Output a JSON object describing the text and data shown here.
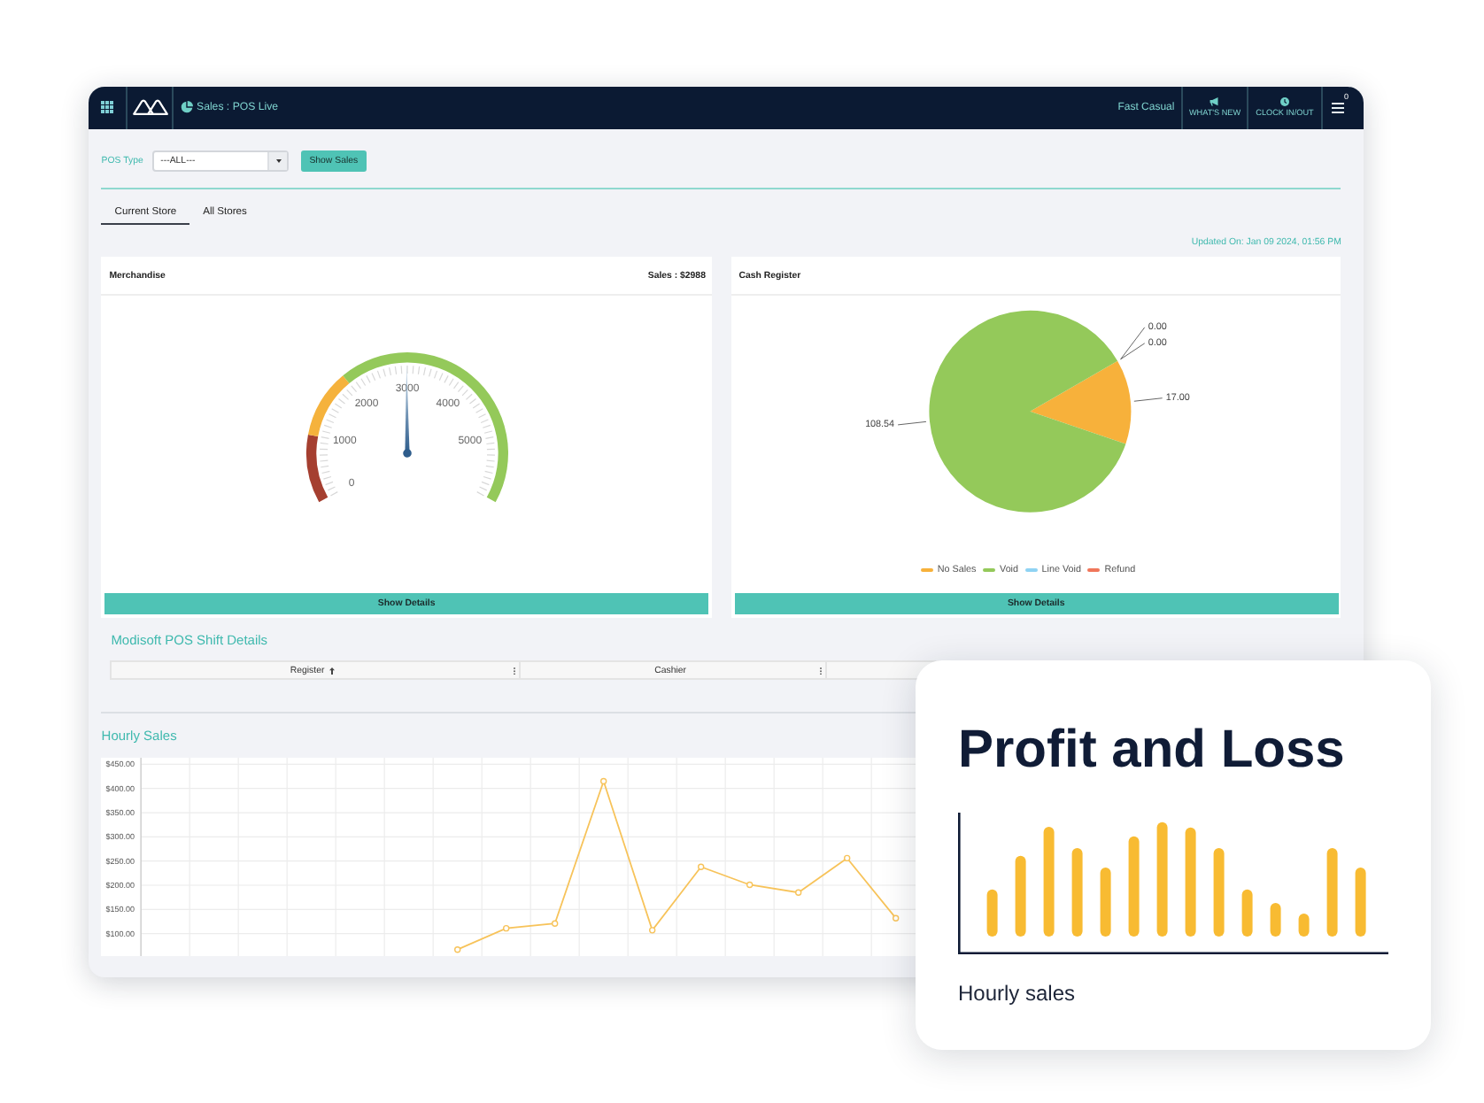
{
  "top_bar": {
    "breadcrumb": "Sales : POS Live",
    "store_type": "Fast Casual",
    "actions": [
      {
        "label": "WHAT'S NEW"
      },
      {
        "label": "CLOCK IN/OUT"
      }
    ],
    "menu_badge": "0"
  },
  "filters": {
    "label": "POS Type",
    "select": {
      "value": "---ALL---"
    },
    "button": "Show Sales"
  },
  "tabs": [
    {
      "label": "Current Store",
      "selected": true
    },
    {
      "label": "All Stores",
      "selected": false
    }
  ],
  "updated": "Updated On: Jan 09 2024, 01:56 PM",
  "cards": [
    {
      "kind": "gauge",
      "title": "Merchandise",
      "total": "Sales : $2988",
      "gauge": {
        "ticks": [
          "0",
          "1000",
          "2000",
          "3000",
          "4000",
          "5000"
        ],
        "level": 0.498,
        "bands": [
          {
            "color": "#a53f30"
          },
          {
            "color": "#f5b23c"
          },
          {
            "color": "#94c95a"
          }
        ]
      },
      "button": "Show Details"
    },
    {
      "kind": "pie",
      "title": "Cash Register",
      "chart_data": {
        "type": "pie",
        "categories": [
          "No Sales",
          "Void",
          "Line Void",
          "Refund"
        ],
        "values": [
          17.0,
          108.54,
          0,
          0
        ],
        "colors": [
          "#f7b13b",
          "#94c95a",
          "#8fd3f3",
          "#f0765a"
        ],
        "value_labels": [
          "17.00",
          "108.54",
          "0.00",
          "0.00"
        ],
        "legend": "bottom"
      },
      "button": "Show Details"
    }
  ],
  "shift_details": {
    "title": "Modisoft POS Shift Details",
    "columns": [
      {
        "label": "Register",
        "sorted": true
      },
      {
        "label": "Cashier",
        "sorted": false
      }
    ]
  },
  "hourly_sales": {
    "title": "Hourly Sales",
    "chart_data": {
      "type": "line",
      "ylim": [
        50,
        450
      ],
      "grid": true,
      "yticks": [
        {
          "value": 450,
          "label": "$450.00"
        },
        {
          "value": 400,
          "label": "$400.00"
        },
        {
          "value": 350,
          "label": "$350.00"
        },
        {
          "value": 300,
          "label": "$300.00"
        },
        {
          "value": 250,
          "label": "$250.00"
        },
        {
          "value": 200,
          "label": "$200.00"
        },
        {
          "value": 150,
          "label": "$150.00"
        },
        {
          "value": 100,
          "label": "$100.00"
        }
      ],
      "series": [
        {
          "color": "#f7c35a",
          "marker": true,
          "values": [
            null,
            null,
            null,
            null,
            null,
            null,
            67,
            111,
            121,
            415,
            107,
            238,
            201,
            185,
            256,
            132
          ]
        }
      ]
    }
  },
  "profit_card": {
    "title": "Profit and Loss",
    "caption": "Hourly sales"
  }
}
